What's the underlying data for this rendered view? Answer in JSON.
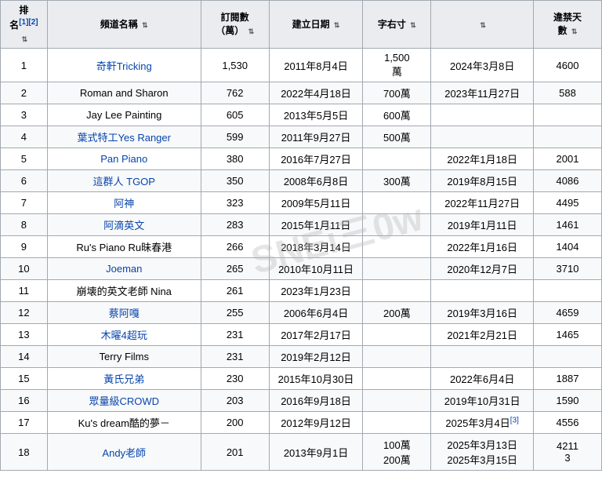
{
  "table": {
    "headers": [
      {
        "label": "排\n名",
        "sub": "[1][2]",
        "class": "col-rank"
      },
      {
        "label": "頻道名稱",
        "class": "col-name"
      },
      {
        "label": "訂閱數\n（萬）",
        "class": "col-subs"
      },
      {
        "label": "建立日期",
        "class": "col-created"
      },
      {
        "label": "字右寸",
        "class": "col-subcount"
      },
      {
        "label": "",
        "class": "col-date2"
      },
      {
        "label": "違禁天\n數",
        "class": "col-days"
      }
    ],
    "rows": [
      {
        "rank": "1",
        "name": "奇軒Tricking",
        "name_link": true,
        "subs": "1,530",
        "created": "2011年8月4日",
        "subcount": "1,500\n萬",
        "date2": "2024年3月8日",
        "days": "4600"
      },
      {
        "rank": "2",
        "name": "Roman and Sharon",
        "name_link": false,
        "subs": "762",
        "created": "2022年4月18日",
        "subcount": "700萬",
        "date2": "2023年11月27日",
        "days": "588"
      },
      {
        "rank": "3",
        "name": "Jay Lee Painting",
        "name_link": false,
        "subs": "605",
        "created": "2013年5月5日",
        "subcount": "600萬",
        "date2": "",
        "days": ""
      },
      {
        "rank": "4",
        "name": "葉式特工Yes Ranger",
        "name_link": true,
        "subs": "599",
        "created": "2011年9月27日",
        "subcount": "500萬",
        "date2": "",
        "days": ""
      },
      {
        "rank": "5",
        "name": "Pan Piano",
        "name_link": true,
        "subs": "380",
        "created": "2016年7月27日",
        "subcount": "",
        "date2": "2022年1月18日",
        "days": "2001"
      },
      {
        "rank": "6",
        "name": "這群人 TGOP",
        "name_link": true,
        "subs": "350",
        "created": "2008年6月8日",
        "subcount": "300萬",
        "date2": "2019年8月15日",
        "days": "4086"
      },
      {
        "rank": "7",
        "name": "阿神",
        "name_link": true,
        "subs": "323",
        "created": "2009年5月11日",
        "subcount": "",
        "date2": "2022年11月27日",
        "days": "4495"
      },
      {
        "rank": "8",
        "name": "阿滴英文",
        "name_link": true,
        "subs": "283",
        "created": "2015年1月11日",
        "subcount": "",
        "date2": "2019年1月11日",
        "days": "1461"
      },
      {
        "rank": "9",
        "name": "Ru's Piano Ru昧春港",
        "name_link": false,
        "subs": "266",
        "created": "2018年3月14日",
        "subcount": "",
        "date2": "2022年1月16日",
        "days": "1404"
      },
      {
        "rank": "10",
        "name": "Joeman",
        "name_link": true,
        "subs": "265",
        "created": "2010年10月11日",
        "subcount": "",
        "date2": "2020年12月7日",
        "days": "3710"
      },
      {
        "rank": "11",
        "name": "崩壊的英文老師 Nina",
        "name_link": false,
        "subs": "261",
        "created": "2023年1月23日",
        "subcount": "",
        "date2": "",
        "days": ""
      },
      {
        "rank": "12",
        "name": "蔡阿嘎",
        "name_link": true,
        "subs": "255",
        "created": "2006年6月4日",
        "subcount": "200萬",
        "date2": "2019年3月16日",
        "days": "4659"
      },
      {
        "rank": "13",
        "name": "木曜4超玩",
        "name_link": true,
        "subs": "231",
        "created": "2017年2月17日",
        "subcount": "",
        "date2": "2021年2月21日",
        "days": "1465"
      },
      {
        "rank": "14",
        "name": "Terry Films",
        "name_link": false,
        "subs": "231",
        "created": "2019年2月12日",
        "subcount": "",
        "date2": "",
        "days": ""
      },
      {
        "rank": "15",
        "name": "黃氏兄弟",
        "name_link": true,
        "subs": "230",
        "created": "2015年10月30日",
        "subcount": "",
        "date2": "2022年6月4日",
        "days": "1887"
      },
      {
        "rank": "16",
        "name": "眾量級CROWD",
        "name_link": true,
        "subs": "203",
        "created": "2016年9月18日",
        "subcount": "",
        "date2": "2019年10月31日",
        "days": "1590"
      },
      {
        "rank": "17",
        "name": "Ku's dream酷的夢－",
        "name_link": false,
        "subs": "200",
        "created": "2012年9月12日",
        "subcount": "",
        "date2": "2025年3月4日[3]",
        "days": "4556"
      },
      {
        "rank": "18",
        "name": "Andy老師",
        "name_link": true,
        "subs": "201",
        "created": "2013年9月1日",
        "subcount": "100萬\n200萬",
        "date2": "2025年3月13日\n2025年3月15日",
        "days": "4211\n3"
      }
    ]
  },
  "watermark": "SNEi三0w"
}
